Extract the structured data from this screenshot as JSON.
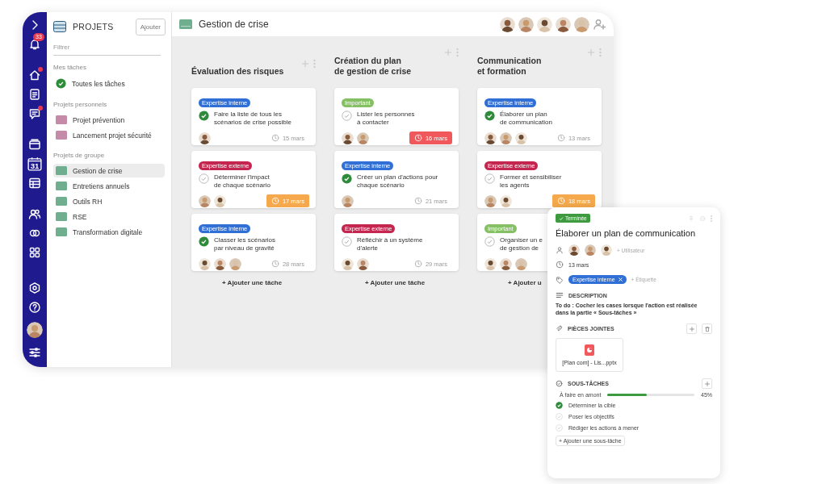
{
  "rail": {
    "groups": [
      [
        {
          "kind": "chevron"
        },
        {
          "kind": "bell",
          "badge": "33"
        }
      ],
      [
        {
          "kind": "home",
          "dot": true
        },
        {
          "kind": "doc",
          "dot": false
        },
        {
          "kind": "chat",
          "dot": true
        }
      ],
      [
        {
          "kind": "folder"
        },
        {
          "kind": "calendar",
          "label": "31"
        },
        {
          "kind": "table"
        }
      ],
      [
        {
          "kind": "people"
        },
        {
          "kind": "toggle"
        },
        {
          "kind": "grid"
        }
      ],
      [
        {
          "kind": "settings"
        },
        {
          "kind": "help"
        },
        {
          "kind": "avatar"
        },
        {
          "kind": "sliders"
        }
      ]
    ]
  },
  "sidebar": {
    "title": "PROJETS",
    "add_button": "Ajouter",
    "filter": {
      "placeholder": "Filtrer"
    },
    "sections": [
      {
        "heading": "Mes tâches",
        "items": [
          {
            "label": "Toutes les tâches",
            "kind": "all",
            "selected": false
          }
        ]
      },
      {
        "heading": "Projets personnels",
        "items": [
          {
            "label": "Projet prévention",
            "kind": "project",
            "color": "#c48aa8",
            "selected": false
          },
          {
            "label": "Lancement projet sécurité",
            "kind": "project",
            "color": "#c48aa8",
            "selected": false
          }
        ]
      },
      {
        "heading": "Projets de groupe",
        "items": [
          {
            "label": "Gestion de crise",
            "kind": "project",
            "color": "#6fae8f",
            "selected": true
          },
          {
            "label": "Entretiens annuels",
            "kind": "project",
            "color": "#6fae8f",
            "selected": false
          },
          {
            "label": "Outils RH",
            "kind": "project",
            "color": "#6fae8f",
            "selected": false
          },
          {
            "label": "RSE",
            "kind": "project",
            "color": "#6fae8f",
            "selected": false
          },
          {
            "label": "Transformation digitale",
            "kind": "project",
            "color": "#6fae8f",
            "selected": false
          }
        ]
      }
    ]
  },
  "board": {
    "title": "Gestion de crise",
    "members": [
      {
        "kind": "avatar"
      },
      {
        "kind": "avatar"
      },
      {
        "kind": "avatar"
      },
      {
        "kind": "avatar"
      },
      {
        "kind": "avatar"
      }
    ],
    "columns": [
      {
        "title": "Évaluation des risques",
        "add_task": "+ Ajouter une tâche",
        "cards": [
          {
            "tag": {
              "label": "Expertise interne",
              "color": "#2f6fd6"
            },
            "done": true,
            "title": "Faire la liste de tous les\nscénarios de crise possible",
            "assignees": [
              {
                "kind": "avatar"
              }
            ],
            "date": "15 mars",
            "late": false,
            "soon": false
          },
          {
            "tag": {
              "label": "Expertise externe",
              "color": "#c4264f"
            },
            "done": false,
            "title": "Déterminer l'impact\nde chaque scénario",
            "assignees": [
              {
                "kind": "avatar"
              },
              {
                "kind": "avatar"
              }
            ],
            "date": "17 mars",
            "late": false,
            "soon": true
          },
          {
            "tag": {
              "label": "Expertise interne",
              "color": "#2f6fd6"
            },
            "done": true,
            "title": "Classer les scénarios\npar niveau de gravité",
            "assignees": [
              {
                "kind": "avatar"
              },
              {
                "kind": "avatar"
              },
              {
                "kind": "avatar"
              }
            ],
            "date": "28 mars",
            "late": false,
            "soon": false
          }
        ]
      },
      {
        "title": "Création du plan\nde gestion de crise",
        "add_task": "+ Ajouter une tâche",
        "cards": [
          {
            "tag": {
              "label": "Important",
              "color": "#86c064"
            },
            "done": false,
            "title": "Lister les personnes\nà contacter",
            "assignees": [
              {
                "kind": "avatar"
              },
              {
                "kind": "avatar"
              }
            ],
            "date": "16 mars",
            "late": true,
            "soon": false
          },
          {
            "tag": {
              "label": "Expertise interne",
              "color": "#2f6fd6"
            },
            "done": true,
            "title": "Créer un plan d'actions pour\nchaque scénario",
            "assignees": [
              {
                "kind": "avatar"
              }
            ],
            "date": "21 mars",
            "late": false,
            "soon": false
          },
          {
            "tag": {
              "label": "Expertise externe",
              "color": "#c4264f"
            },
            "done": false,
            "title": "Réfléchir à un système\nd'alerte",
            "assignees": [
              {
                "kind": "avatar"
              },
              {
                "kind": "avatar"
              }
            ],
            "date": "29 mars",
            "late": false,
            "soon": false
          }
        ]
      },
      {
        "title": "Communication\net formation",
        "add_task": "+ Ajouter u",
        "cards": [
          {
            "tag": {
              "label": "Expertise interne",
              "color": "#2f6fd6"
            },
            "done": true,
            "title": "Élaborer un plan\nde communication",
            "assignees": [
              {
                "kind": "avatar"
              },
              {
                "kind": "avatar"
              },
              {
                "kind": "avatar"
              }
            ],
            "date": "13 mars",
            "late": false,
            "soon": false
          },
          {
            "tag": {
              "label": "Expertise externe",
              "color": "#c4264f"
            },
            "done": false,
            "title": "Former et sensibiliser\nles agents",
            "assignees": [
              {
                "kind": "avatar"
              },
              {
                "kind": "avatar"
              }
            ],
            "date": "18 mars",
            "late": false,
            "soon": true
          },
          {
            "tag": {
              "label": "Important",
              "color": "#86c064"
            },
            "done": false,
            "title": "Organiser un e\nde gestion de",
            "assignees": [
              {
                "kind": "avatar"
              },
              {
                "kind": "avatar"
              },
              {
                "kind": "avatar"
              }
            ]
          }
        ]
      }
    ]
  },
  "detail": {
    "status": "Terminée",
    "title": "Élaborer un plan de communication",
    "assignees": [
      {
        "kind": "avatar"
      },
      {
        "kind": "avatar"
      },
      {
        "kind": "avatar"
      }
    ],
    "add_user": "+ Utilisateur",
    "date": "13 mars",
    "tags": [
      {
        "label": "Expertise interne",
        "color": "#2f6fd6"
      }
    ],
    "add_tag": "+ Étiquette",
    "description": {
      "heading": "DESCRIPTION",
      "text": "To do : Cocher les cases lorsque l'action est réalisée\ndans la partie « Sous-tâches »"
    },
    "attachments": {
      "heading": "PIÈCES JOINTES",
      "files": [
        {
          "name": "[Plan com] - Lis...pptx"
        }
      ]
    },
    "subtasks": {
      "heading": "SOUS-TÂCHES",
      "group": {
        "label": "À faire en amont",
        "level": 0.45,
        "reading": "45%"
      },
      "items": [
        {
          "label": "Déterminer la cible",
          "checked": true
        },
        {
          "label": "Poser les objectifs",
          "checked": false
        },
        {
          "label": "Rédiger les actions à mener",
          "checked": false
        }
      ],
      "add": "+ Ajouter une sous-tâche"
    }
  }
}
